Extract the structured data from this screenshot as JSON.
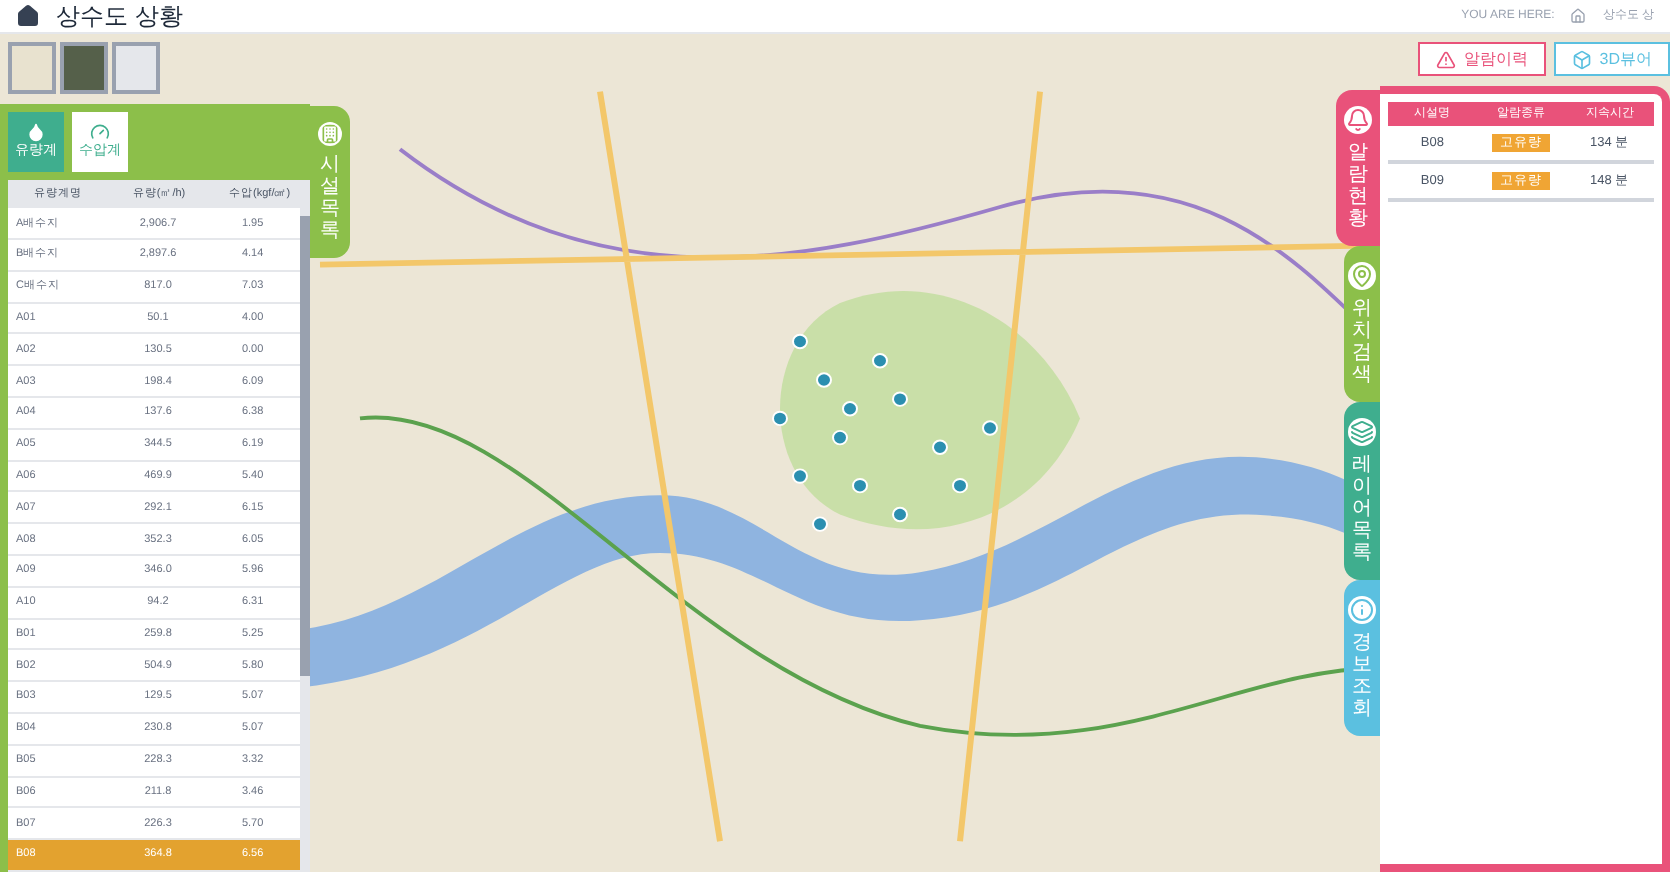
{
  "header": {
    "title": "상수도 상황",
    "breadcrumb_label": "YOU ARE HERE:",
    "breadcrumb_current": "상수도 상"
  },
  "map_layers": [
    {
      "kind": "street",
      "selected": false
    },
    {
      "kind": "satellite",
      "selected": false
    },
    {
      "kind": "gray",
      "selected": false
    }
  ],
  "left_panel": {
    "tabs": [
      {
        "label": "유량계",
        "selected": true
      },
      {
        "label": "수압계",
        "selected": false
      }
    ],
    "columns": [
      "유량계명",
      "유량(㎥/h)",
      "수압(kgf/㎠)"
    ],
    "rows": [
      {
        "name": "A배수지",
        "flow": "2,906.7",
        "pressure": "1.95",
        "selected": false
      },
      {
        "name": "B배수지",
        "flow": "2,897.6",
        "pressure": "4.14",
        "selected": false
      },
      {
        "name": "C배수지",
        "flow": "817.0",
        "pressure": "7.03",
        "selected": false
      },
      {
        "name": "A01",
        "flow": "50.1",
        "pressure": "4.00",
        "selected": false
      },
      {
        "name": "A02",
        "flow": "130.5",
        "pressure": "0.00",
        "selected": false
      },
      {
        "name": "A03",
        "flow": "198.4",
        "pressure": "6.09",
        "selected": false
      },
      {
        "name": "A04",
        "flow": "137.6",
        "pressure": "6.38",
        "selected": false
      },
      {
        "name": "A05",
        "flow": "344.5",
        "pressure": "6.19",
        "selected": false
      },
      {
        "name": "A06",
        "flow": "469.9",
        "pressure": "5.40",
        "selected": false
      },
      {
        "name": "A07",
        "flow": "292.1",
        "pressure": "6.15",
        "selected": false
      },
      {
        "name": "A08",
        "flow": "352.3",
        "pressure": "6.05",
        "selected": false
      },
      {
        "name": "A09",
        "flow": "346.0",
        "pressure": "5.96",
        "selected": false
      },
      {
        "name": "A10",
        "flow": "94.2",
        "pressure": "6.31",
        "selected": false
      },
      {
        "name": "B01",
        "flow": "259.8",
        "pressure": "5.25",
        "selected": false
      },
      {
        "name": "B02",
        "flow": "504.9",
        "pressure": "5.80",
        "selected": false
      },
      {
        "name": "B03",
        "flow": "129.5",
        "pressure": "5.07",
        "selected": false
      },
      {
        "name": "B04",
        "flow": "230.8",
        "pressure": "5.07",
        "selected": false
      },
      {
        "name": "B05",
        "flow": "228.3",
        "pressure": "3.32",
        "selected": false
      },
      {
        "name": "B06",
        "flow": "211.8",
        "pressure": "3.46",
        "selected": false
      },
      {
        "name": "B07",
        "flow": "226.3",
        "pressure": "5.70",
        "selected": false
      },
      {
        "name": "B08",
        "flow": "364.8",
        "pressure": "6.56",
        "selected": true
      }
    ]
  },
  "left_side_tab": {
    "label": "시설목록"
  },
  "top_buttons": [
    {
      "kind": "alarm",
      "label": "알람이력"
    },
    {
      "kind": "view3d",
      "label": "3D뷰어"
    }
  ],
  "side_tabs": [
    {
      "label": "알람현황",
      "color": "#e9527a",
      "kind": "alarm",
      "selected": true
    },
    {
      "label": "위치검색",
      "color": "#8cbf4a",
      "kind": "pin",
      "selected": false
    },
    {
      "label": "레이어목록",
      "color": "#3fae8e",
      "kind": "layers",
      "selected": false
    },
    {
      "label": "경보조회",
      "color": "#5bc0e0",
      "kind": "info",
      "selected": false
    }
  ],
  "alarm_table": {
    "columns": [
      "시설명",
      "알람종류",
      "지속시간"
    ],
    "rows": [
      {
        "facility": "B08",
        "type": "고유량",
        "duration": "134 분"
      },
      {
        "facility": "B09",
        "type": "고유량",
        "duration": "148 분"
      }
    ]
  }
}
